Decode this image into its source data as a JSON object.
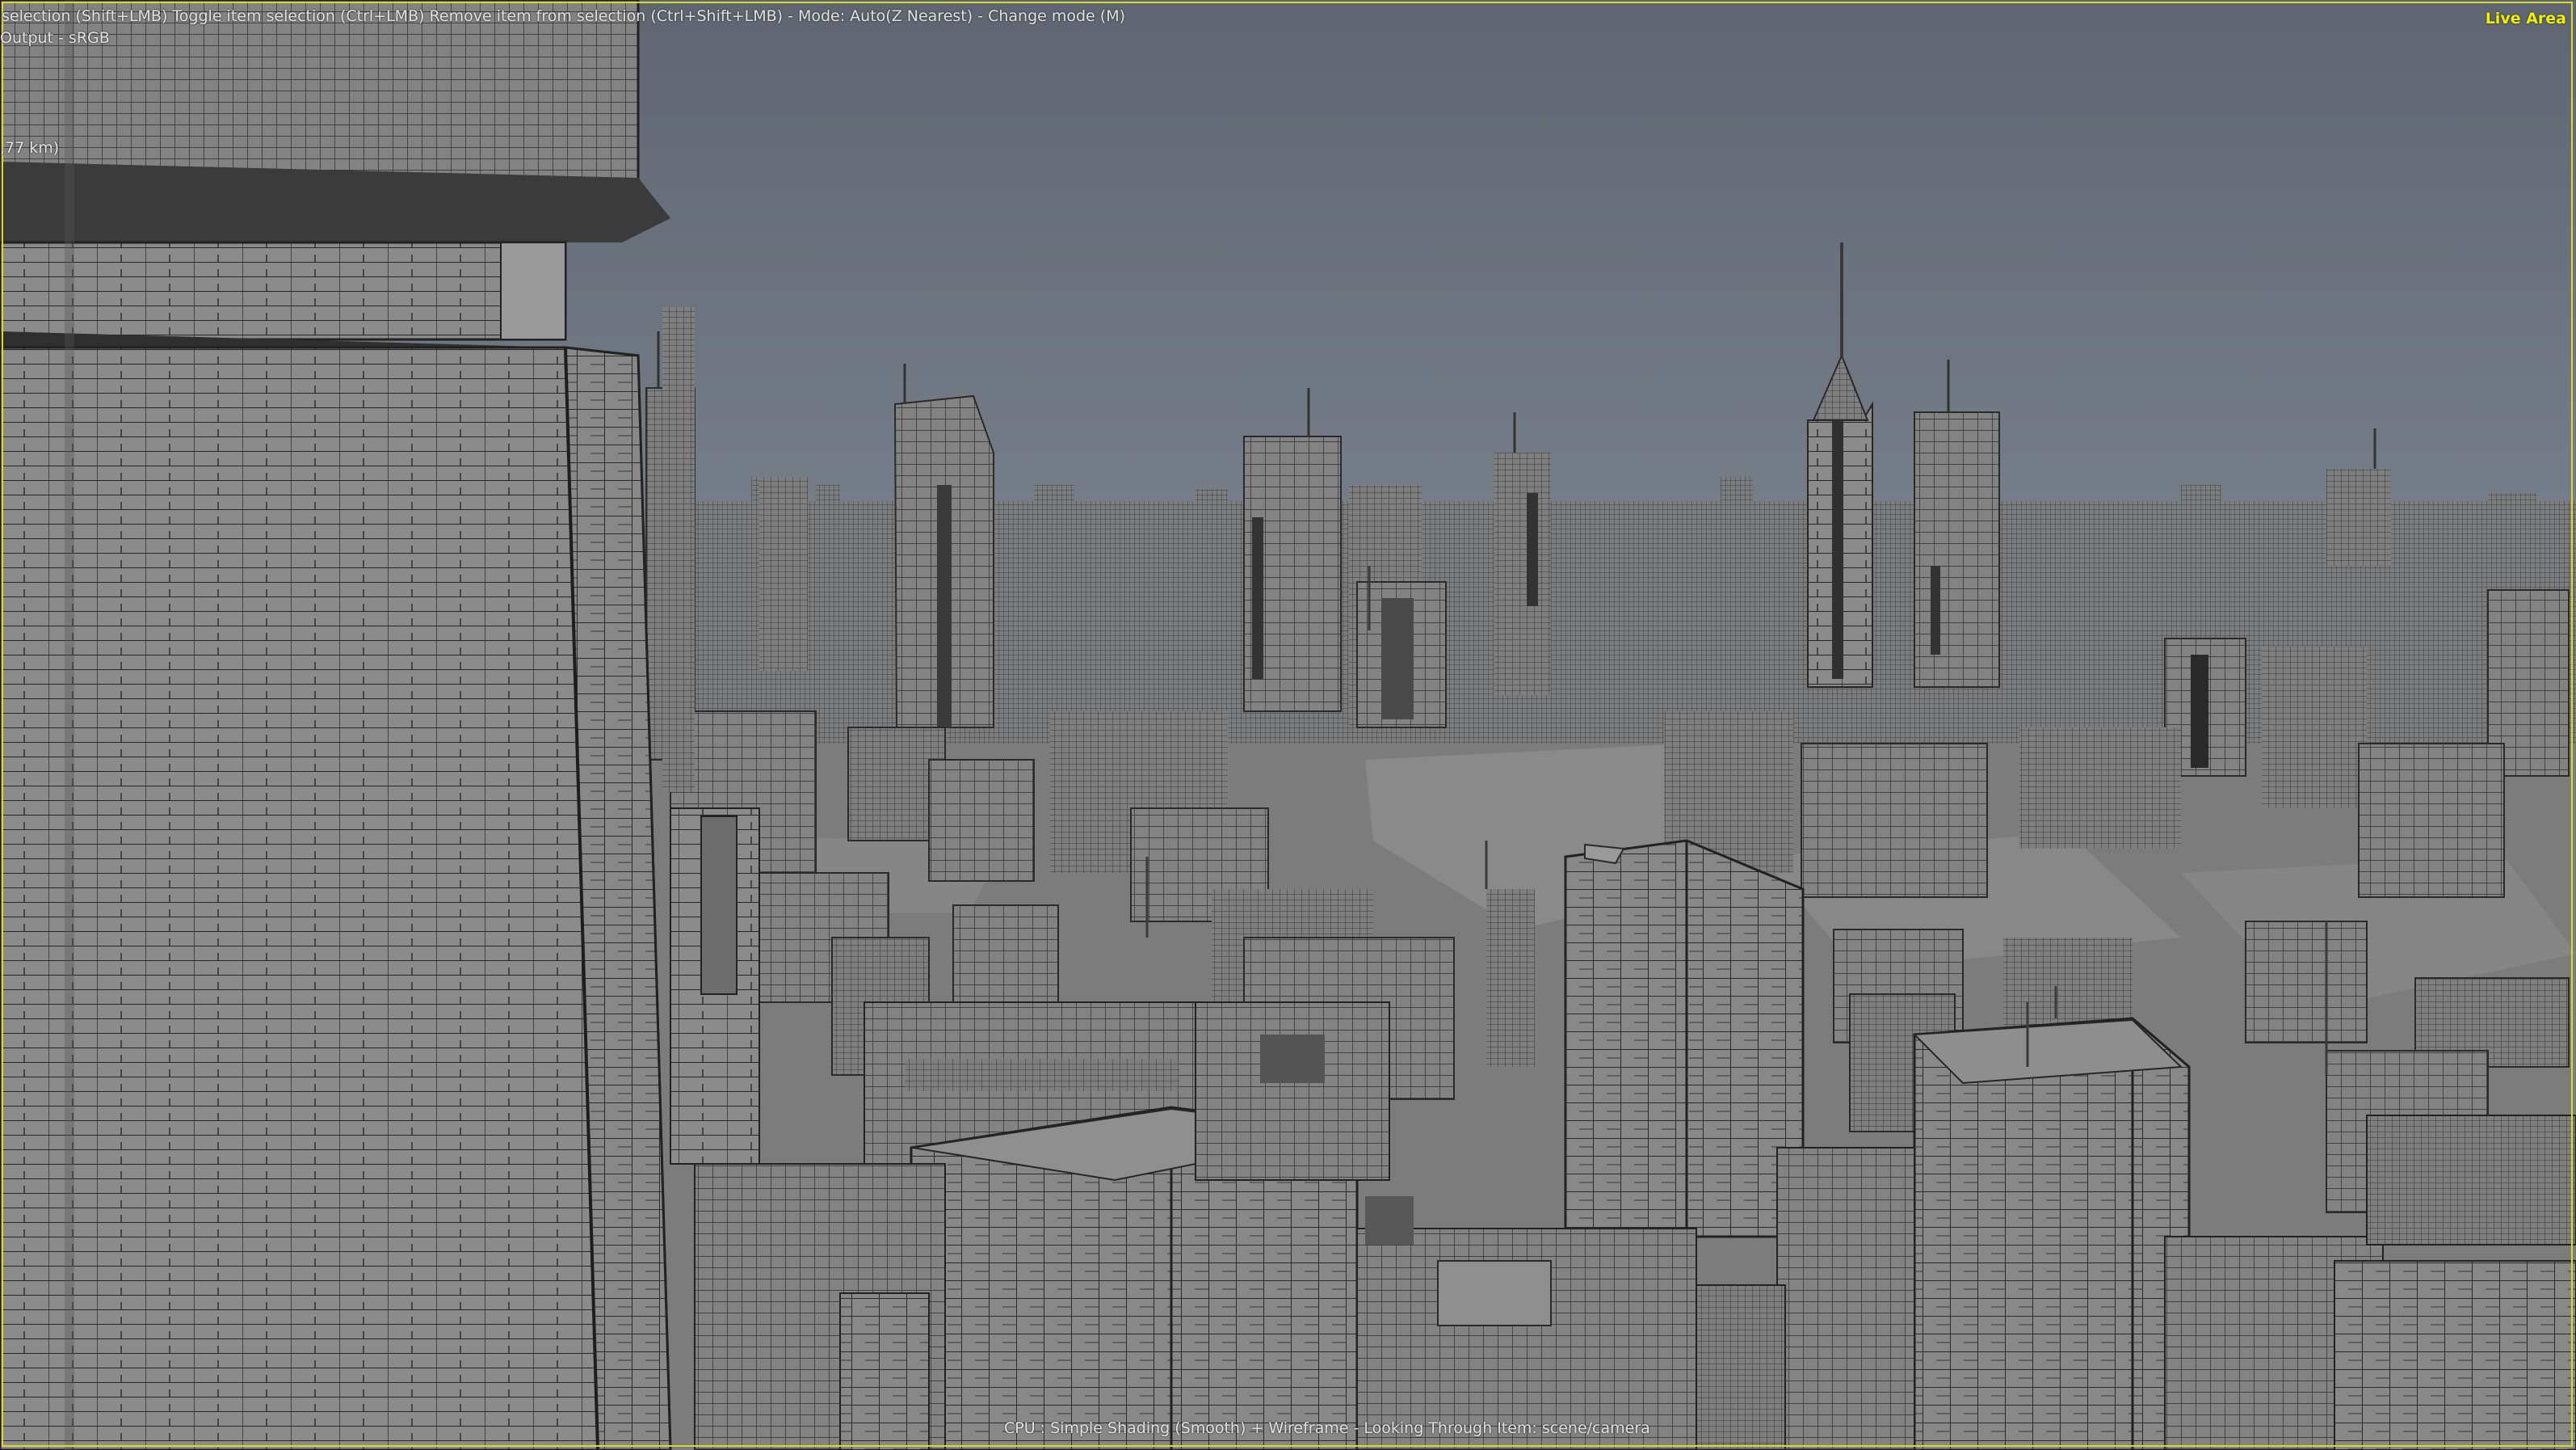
{
  "hud": {
    "hints": "selection (Shift+LMB)  Toggle item selection (Ctrl+LMB)  Remove item from selection (Ctrl+Shift+LMB)  - Mode: Auto(Z Nearest) - Change mode (M)",
    "output": "Output - sRGB",
    "distance": ",77 km)",
    "live_area": "Live Area",
    "status": "CPU : Simple Shading (Smooth) + Wireframe - Looking Through Item: scene/camera"
  },
  "colors": {
    "sky_top": "#5f6671",
    "sky_bottom": "#737b87",
    "ground": "#7e7e7e",
    "building_fill": "#8a8a8a",
    "wire": "#2a2a2a",
    "live_area": "#d8d830"
  }
}
